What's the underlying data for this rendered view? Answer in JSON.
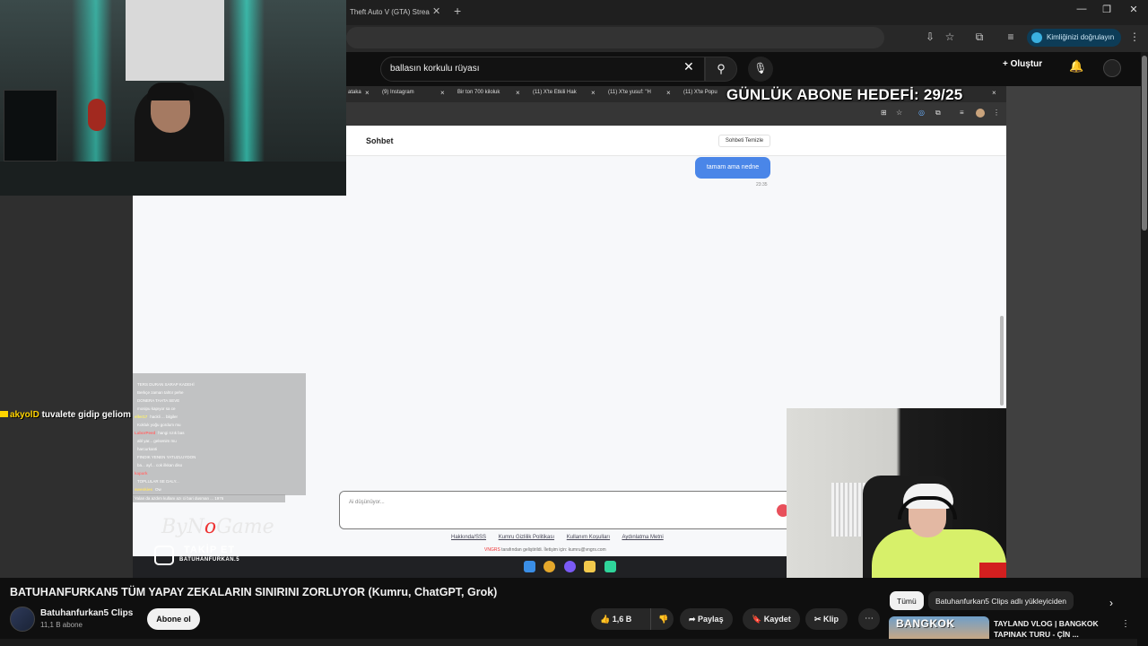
{
  "browser": {
    "tab_title": "Theft Auto V (GTA) Strea",
    "verify_label": "Kimliğinizi doğrulayın"
  },
  "youtube": {
    "search_value": "ballasın korkulu rüyası",
    "create_label": "Oluştur",
    "scrollbar_color": "#777777"
  },
  "stream": {
    "inner_tabs": [
      {
        "label": "ataka"
      },
      {
        "label": "(9) Instagram"
      },
      {
        "label": "Bir ton 700 kiloluk"
      },
      {
        "label": "(11) X'te Etkili Hak"
      },
      {
        "label": "(11) X'te yusuf: \"H"
      },
      {
        "label": "(11) X'te Popu"
      }
    ],
    "sub_goal": "GÜNLÜK ABONE HEDEFİ: 29/25",
    "app": {
      "title": "Sohbet",
      "clear_button": "Sohbeti Temizle",
      "message": "tamam ama nedne",
      "message_time": "23:35",
      "input_placeholder": "Ai düşünüyor...",
      "footer_links": [
        "Hakkında/SSS",
        "Kumru Gizlilik Politikası",
        "Kullanım Koşulları",
        "Aydınlatma Metni"
      ],
      "footer_brand": "VNGRS",
      "footer_credit": "tarafından geliştirildi. İletişim için: kumru@vngrs.com"
    },
    "alert": {
      "user": "akyolD",
      "text": "tuvalete gidip geliom"
    },
    "chat_lines": [
      {
        "user": "",
        "text": "",
        "color": "#6ea8ff"
      },
      {
        "user": "",
        "text": "TERS DURAN SARAP KADEHİ",
        "color": "#b57cff"
      },
      {
        "user": "",
        "text": "Berkçe zaman tahtır pehe",
        "color": "#ff8bd1"
      },
      {
        "user": "",
        "text": "DONERA TAHTA SEVE",
        "color": "#7bffb1"
      },
      {
        "user": "",
        "text": "mosipu kapıyor sa ce",
        "color": "#ffda6b"
      },
      {
        "user": "eller17",
        "text": "hackli ... bilgiler",
        "color": "#fff36b"
      },
      {
        "user": "",
        "text": "Kokluk yoğu gordum mu",
        "color": "#ff9b6b"
      },
      {
        "user": "LaborPeed",
        "text": "hangi rızık bas",
        "color": "#ff6b6b"
      },
      {
        "user": "",
        "text": "abl yar... gelsenim mu",
        "color": "#c6c6c6"
      },
      {
        "user": "",
        "text": "harcurkanti",
        "color": "#c6c6c6"
      },
      {
        "user": "",
        "text": "FINDIK YENEN YATUZLUYDON",
        "color": "#9effd2"
      },
      {
        "user": "",
        "text": "ba... ayf... cok ilkkan diso",
        "color": "#8fe3ff"
      },
      {
        "user": "kapark",
        "text": "",
        "color": "#ff7272"
      },
      {
        "user": "",
        "text": "TOPLULAR SE DALY...",
        "color": "#ffb36b"
      },
      {
        "user": "swenkies",
        "text": "Ow",
        "color": "#ffe36b"
      }
    ],
    "chat_last": "Yalan da azdım kullanı azı ci bari dusman ... 1976",
    "sponsor_left": "ByN",
    "sponsor_o": "o",
    "sponsor_right": "Game",
    "follow_title": "TAKİP ET",
    "follow_handle": "BATUHANFURKAN.5"
  },
  "video": {
    "title": "BATUHANFURKAN5 TÜM YAPAY ZEKALARIN SINIRINI ZORLUYOR (Kumru, ChatGPT, Grok)",
    "channel": "Batuhanfurkan5 Clips",
    "subscribers": "11,1 B abone",
    "subscribe_label": "Abone ol",
    "likes": "1,6 B",
    "share_label": "Paylaş",
    "save_label": "Kaydet",
    "clip_label": "Klip"
  },
  "sidebar": {
    "chips": [
      "Tümü",
      "Batuhanfurkan5 Clips adlı yükleyiciden"
    ],
    "rec_thumb_text": "BANGKOK",
    "rec_title": "TAYLAND VLOG | BANGKOK TAPINAK TURU - ÇİN ..."
  }
}
